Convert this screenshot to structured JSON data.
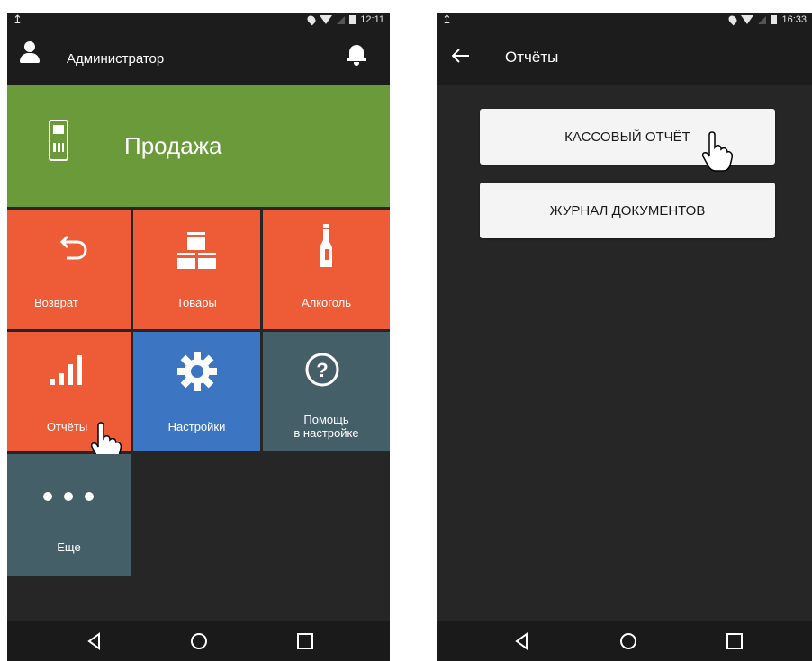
{
  "left_screen": {
    "status": {
      "upload_glyph": "↥",
      "time": "12:11"
    },
    "header": {
      "user": "Администратор"
    },
    "sale_tile": {
      "label": "Продажа"
    },
    "tiles": [
      {
        "label": "Возврат",
        "color": "#ee5c37",
        "icon": "return-icon"
      },
      {
        "label": "Товары",
        "color": "#ee5c37",
        "icon": "goods-icon"
      },
      {
        "label": "Алкоголь",
        "color": "#ee5c37",
        "icon": "bottle-icon"
      },
      {
        "label": "Отчёты",
        "color": "#ee5c37",
        "icon": "bars-icon"
      },
      {
        "label": "Настройки",
        "color": "#3c76c3",
        "icon": "gear-icon"
      },
      {
        "label_line1": "Помощь",
        "label_line2": "в настройке",
        "color": "#455f68",
        "icon": "help-icon"
      },
      {
        "label": "Еще",
        "color": "#455f68",
        "icon": "dots-icon"
      }
    ]
  },
  "right_screen": {
    "status": {
      "upload_glyph": "↥",
      "time": "16:33"
    },
    "header": {
      "title": "Отчёты"
    },
    "buttons": [
      {
        "label": "КАССОВЫЙ ОТЧЁТ"
      },
      {
        "label": "ЖУРНАЛ ДОКУМЕНТОВ"
      }
    ]
  },
  "colors": {
    "sale_green": "#6a9a3a",
    "tile_orange": "#ee5c37",
    "tile_blue": "#3c76c3",
    "tile_slate": "#455f68",
    "background_dark": "#262626"
  }
}
